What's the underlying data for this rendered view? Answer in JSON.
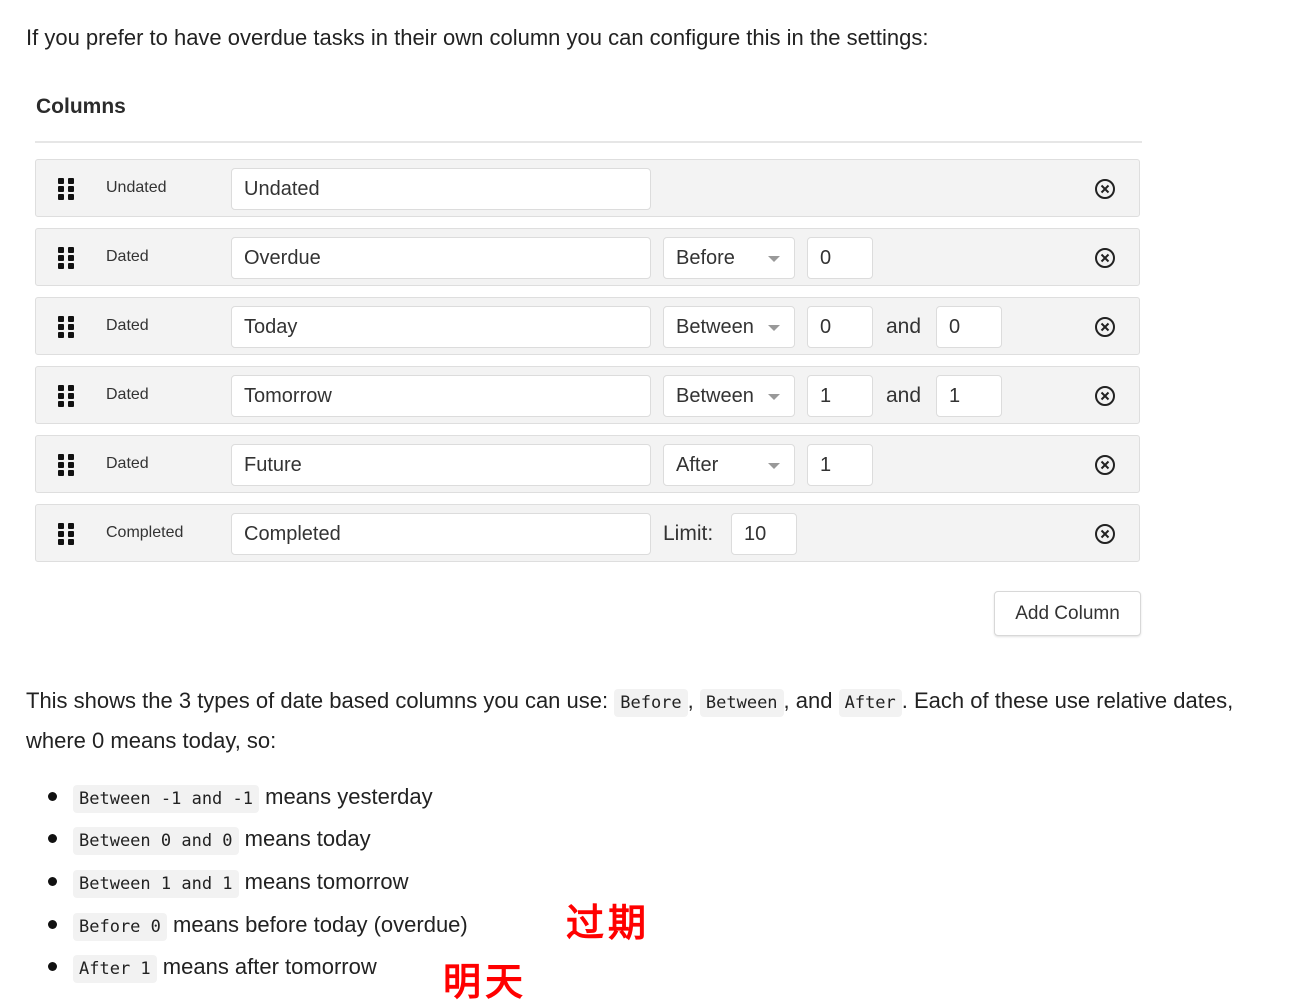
{
  "intro_text": "If you prefer to have overdue tasks in their own column you can configure this in the settings:",
  "settings": {
    "title": "Columns",
    "rows": [
      {
        "type": "Undated",
        "name": "Undated"
      },
      {
        "type": "Dated",
        "name": "Overdue",
        "operator": "Before",
        "value1": "0"
      },
      {
        "type": "Dated",
        "name": "Today",
        "operator": "Between",
        "value1": "0",
        "and_label": "and",
        "value2": "0"
      },
      {
        "type": "Dated",
        "name": "Tomorrow",
        "operator": "Between",
        "value1": "1",
        "and_label": "and",
        "value2": "1"
      },
      {
        "type": "Dated",
        "name": "Future",
        "operator": "After",
        "value1": "1"
      },
      {
        "type": "Completed",
        "name": "Completed",
        "limit_label": "Limit:",
        "limit": "10"
      }
    ],
    "add_button": "Add Column",
    "icons": {
      "handle": "drag-handle-icon",
      "remove": "remove-circle-icon",
      "dropdown": "caret-down-icon"
    }
  },
  "explanation": {
    "part1": "This shows the 3 types of date based columns you can use: ",
    "code_before": "Before",
    "sep1": ", ",
    "code_between": "Between",
    "sep2": ", and ",
    "code_after": "After",
    "part2": ". Each of these use relative dates, where 0 means today, so:"
  },
  "examples": [
    {
      "code": "Between -1 and -1",
      "text": "means yesterday"
    },
    {
      "code": "Between 0 and 0",
      "text": "means today"
    },
    {
      "code": "Between 1 and 1",
      "text": "means tomorrow"
    },
    {
      "code": "Before 0",
      "text": "means before today (overdue)"
    },
    {
      "code": "After 1",
      "text": "means after tomorrow"
    }
  ],
  "annotations": {
    "overdue_note": "过期",
    "tomorrow_note": "明天",
    "color": "#ff0000"
  }
}
